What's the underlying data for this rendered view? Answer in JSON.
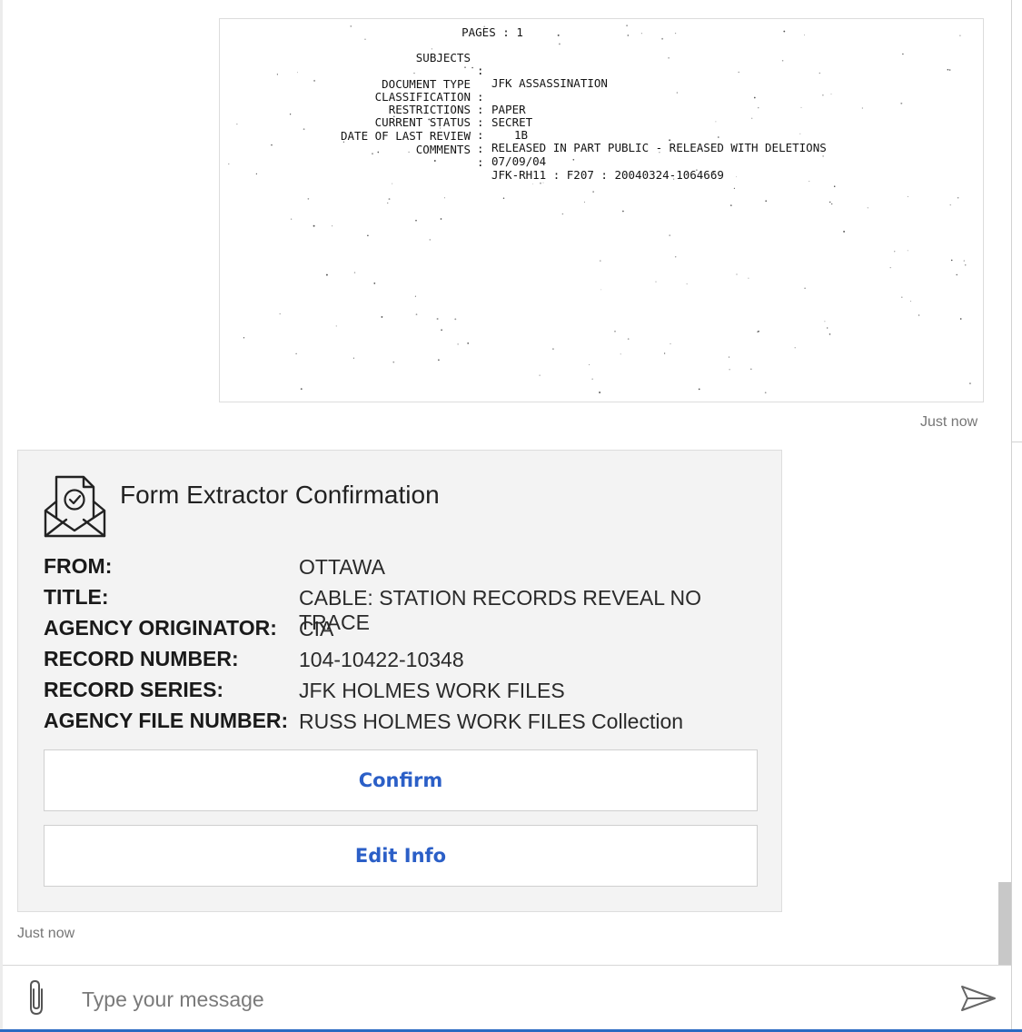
{
  "document_scan": {
    "partial_top_line": "PAGES : 1",
    "fields": [
      {
        "label": "SUBJECTS",
        "value": "JFK ASSASSINATION"
      },
      {
        "label": "DOCUMENT TYPE",
        "value": "PAPER"
      },
      {
        "label": "CLASSIFICATION",
        "value": "SECRET"
      },
      {
        "label": "RESTRICTIONS",
        "value": "1B"
      },
      {
        "label": "CURRENT STATUS",
        "value": "RELEASED IN PART PUBLIC - RELEASED WITH DELETIONS"
      },
      {
        "label": "DATE OF LAST REVIEW",
        "value": "07/09/04"
      },
      {
        "label": "COMMENTS",
        "value": "JFK-RH11 : F207 : 20040324-1064669"
      }
    ],
    "separator": ":"
  },
  "timestamps": {
    "image_message": "Just now",
    "card_message": "Just now"
  },
  "card": {
    "icon": "envelope-check-icon",
    "title": "Form Extractor Confirmation",
    "facts": [
      {
        "key": "FROM:",
        "value": "OTTAWA"
      },
      {
        "key": "TITLE:",
        "value": "CABLE: STATION RECORDS REVEAL NO TRACE"
      },
      {
        "key": "AGENCY ORIGINATOR:",
        "value": "CIA"
      },
      {
        "key": "RECORD NUMBER:",
        "value": "104-10422-10348"
      },
      {
        "key": "RECORD SERIES:",
        "value": "JFK HOLMES WORK FILES"
      },
      {
        "key": "AGENCY FILE NUMBER:",
        "value": "RUSS HOLMES WORK FILES Collection"
      }
    ],
    "actions": {
      "confirm": "Confirm",
      "edit": "Edit Info"
    }
  },
  "composer": {
    "placeholder": "Type your message",
    "attach_icon": "paperclip-icon",
    "send_icon": "send-icon"
  },
  "colors": {
    "accent": "#2b6ac2",
    "button_text": "#2b5fc7",
    "card_background": "#f3f3f3",
    "timestamp": "#767676"
  }
}
